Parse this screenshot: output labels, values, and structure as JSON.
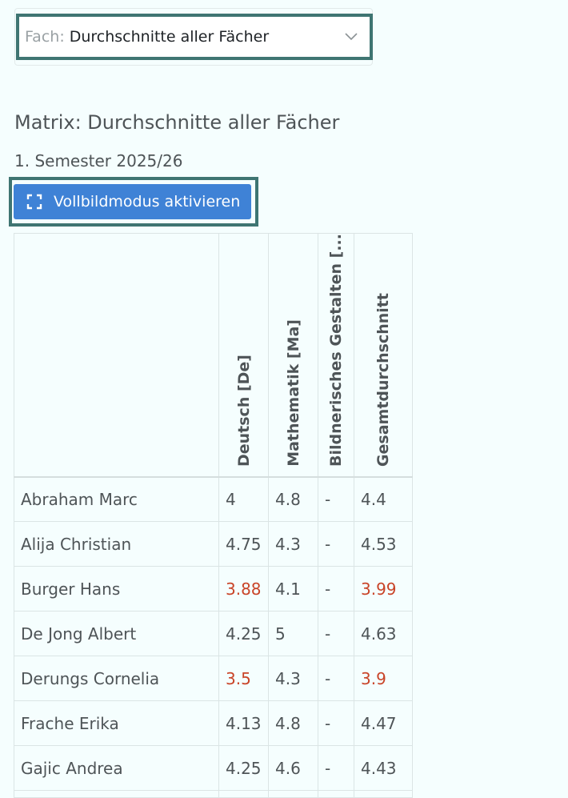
{
  "subject_filter": {
    "label": "Fach:",
    "value": "Durchschnitte aller Fächer"
  },
  "page": {
    "title": "Matrix: Durchschnitte aller Fächer",
    "semester": "1. Semester 2025/26"
  },
  "fullscreen_button": {
    "label": "Vollbildmodus aktivieren",
    "color": "#3f82d6"
  },
  "table": {
    "columns": [
      "Deutsch [De]",
      "Mathematik [Ma]",
      "Bildnerisches Gestalten [...",
      "Gesamtdurchschnitt"
    ],
    "low_grade_color": "#c94428",
    "rows": [
      {
        "name": "Abraham Marc",
        "de": "4",
        "ma": "4.8",
        "bg": "-",
        "gd": "4.4"
      },
      {
        "name": "Alija Christian",
        "de": "4.75",
        "ma": "4.3",
        "bg": "-",
        "gd": "4.53"
      },
      {
        "name": "Burger Hans",
        "de": "3.88",
        "ma": "4.1",
        "bg": "-",
        "gd": "3.99"
      },
      {
        "name": "De Jong Albert",
        "de": "4.25",
        "ma": "5",
        "bg": "-",
        "gd": "4.63"
      },
      {
        "name": "Derungs Cornelia",
        "de": "3.5",
        "ma": "4.3",
        "bg": "-",
        "gd": "3.9"
      },
      {
        "name": "Frache Erika",
        "de": "4.13",
        "ma": "4.8",
        "bg": "-",
        "gd": "4.47"
      },
      {
        "name": "Gajic Andrea",
        "de": "4.25",
        "ma": "4.6",
        "bg": "-",
        "gd": "4.43"
      }
    ]
  }
}
